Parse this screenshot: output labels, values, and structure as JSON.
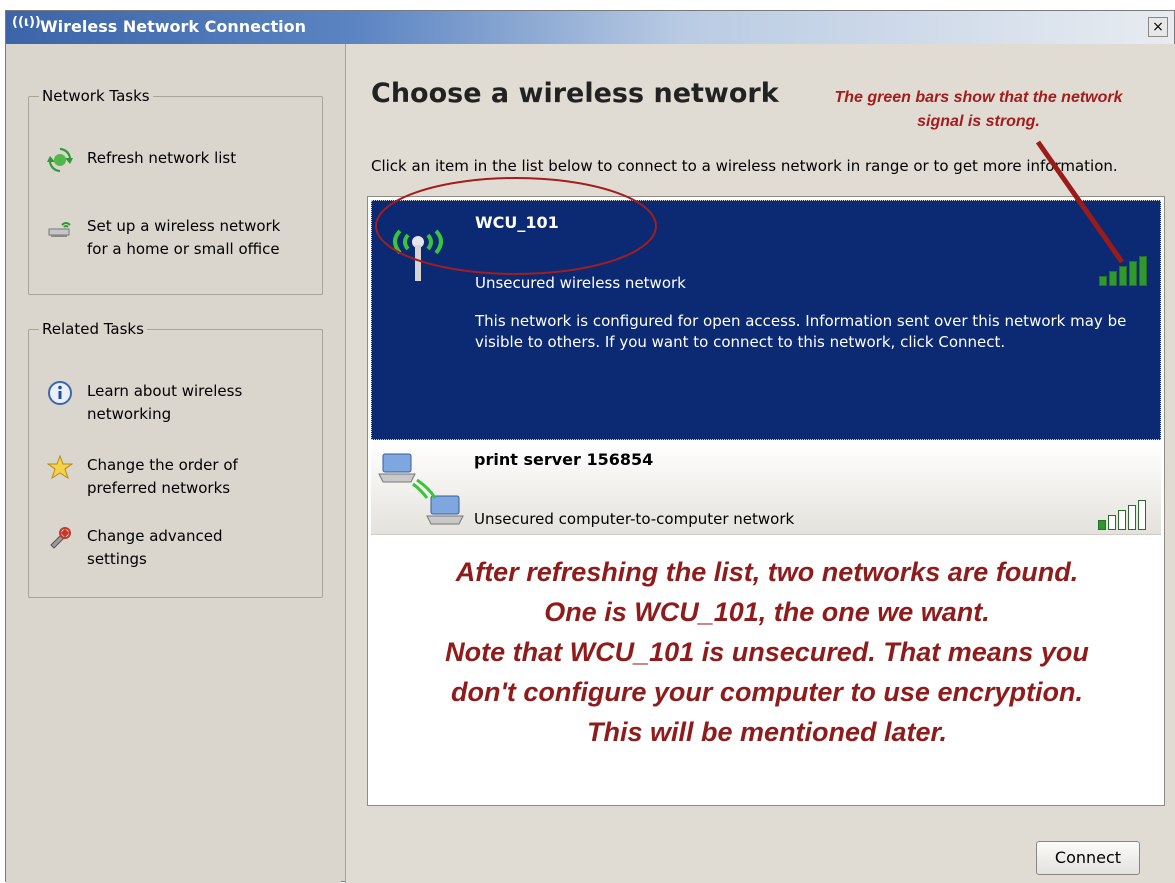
{
  "window": {
    "title": "Wireless Network Connection",
    "close_glyph": "×",
    "title_icon": "wireless-icon"
  },
  "sidebar": {
    "network_tasks": {
      "title": "Network Tasks",
      "items": [
        {
          "label": "Refresh network list",
          "icon": "refresh-icon"
        },
        {
          "label": "Set up a wireless network\nfor a home or small office",
          "icon": "setup-wireless-icon"
        }
      ]
    },
    "related_tasks": {
      "title": "Related Tasks",
      "items": [
        {
          "label": "Learn about wireless\nnetworking",
          "icon": "info-icon"
        },
        {
          "label": "Change the order of\npreferred networks",
          "icon": "star-icon"
        },
        {
          "label": "Change advanced\nsettings",
          "icon": "settings-icon"
        }
      ]
    }
  },
  "main": {
    "heading": "Choose a wireless network",
    "description": "Click an item in the list below to connect to a wireless network in range or to get more information.",
    "annotation_top": "The green bars show that the network\nsignal is strong.",
    "networks": [
      {
        "ssid": "WCU_101",
        "security": "Unsecured wireless network",
        "details": "This network is configured for open access. Information sent over this network may be visible to others. If you want to connect to this network, click Connect.",
        "signal_bars": 5,
        "selected": true,
        "icon": "wireless-antenna-icon"
      },
      {
        "ssid": "print server 156854",
        "security": "Unsecured computer-to-computer network",
        "signal_bars": 1,
        "selected": false,
        "icon": "computer-to-computer-icon"
      }
    ],
    "annotation_main": "After refreshing the list, two networks are found.\nOne is WCU_101, the one we want.\nNote that WCU_101 is unsecured. That means you\ndon't configure your computer to use encryption.\nThis will be mentioned later.",
    "connect_label": "Connect"
  },
  "colors": {
    "selected_bg": "#0b2a73",
    "annotation": "#8f1b1b",
    "signal_green": "#2e9a2e",
    "signal_empty": "#ffffff"
  }
}
